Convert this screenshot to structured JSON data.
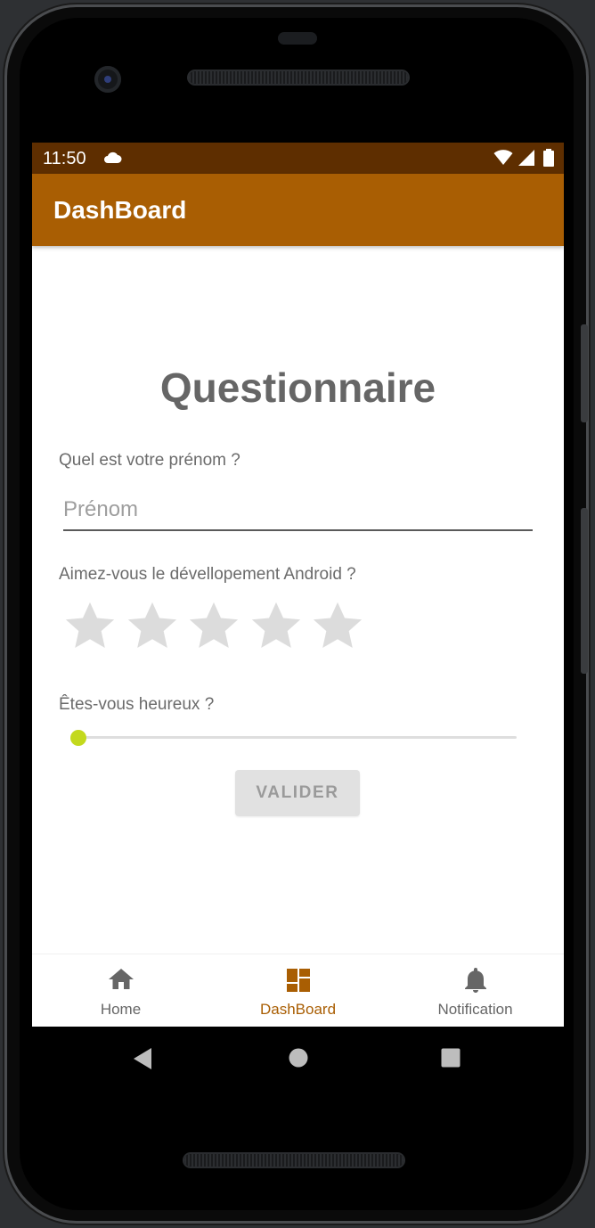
{
  "status_bar": {
    "time": "11:50",
    "icons": [
      "cloud-icon",
      "wifi-icon",
      "signal-icon",
      "battery-icon"
    ]
  },
  "app_bar": {
    "title": "DashBoard"
  },
  "questionnaire": {
    "title": "Questionnaire",
    "name_question": "Quel est votre prénom ?",
    "name_placeholder": "Prénom",
    "name_value": "",
    "android_question": "Aimez-vous le dévellopement Android ?",
    "rating": 0,
    "rating_max": 5,
    "happy_question": "Êtes-vous heureux ?",
    "happiness_level": 0,
    "submit_label": "VALIDER"
  },
  "bottom_nav": {
    "items": [
      {
        "label": "Home",
        "icon": "home-icon",
        "active": false
      },
      {
        "label": "DashBoard",
        "icon": "dashboard-icon",
        "active": true
      },
      {
        "label": "Notification",
        "icon": "bell-icon",
        "active": false
      }
    ]
  },
  "system_nav": {
    "icons": [
      "back-icon",
      "home-circle-icon",
      "recents-icon"
    ]
  },
  "colors": {
    "status_bar": "#5e2e00",
    "app_bar": "#a95e03",
    "accent": "#a95e03",
    "slider": "#c3d91d",
    "star_empty": "#dcdcdc",
    "nav_inactive": "#666666"
  }
}
